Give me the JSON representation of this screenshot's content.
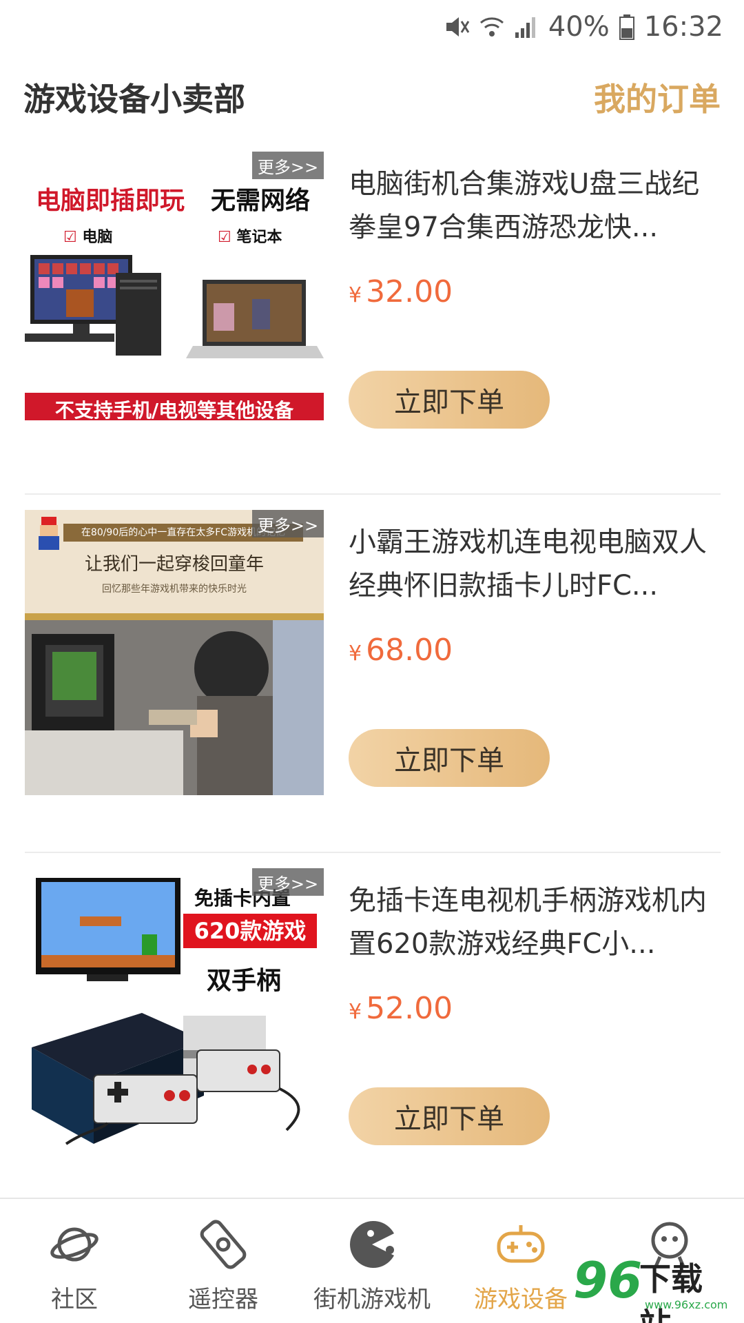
{
  "status_bar": {
    "battery": "40%",
    "time": "16:32"
  },
  "header": {
    "title": "游戏设备小卖部",
    "orders_link": "我的订单"
  },
  "products": [
    {
      "title": "电脑街机合集游戏U盘三战纪拳皇97合集西游恐龙快...",
      "currency": "¥",
      "price": "32.00",
      "more": "更多>>",
      "button": "立即下单",
      "image": {
        "line1_red": "电脑即插即玩",
        "line1_black": "无需网络",
        "check1": "电脑",
        "check2": "笔记本",
        "banner": "不支持手机/电视等其他设备"
      }
    },
    {
      "title": "小霸王游戏机连电视电脑双人经典怀旧款插卡儿时FC...",
      "currency": "¥",
      "price": "68.00",
      "more": "更多>>",
      "button": "立即下单",
      "image": {
        "caption_top": "在80/90后的心中一直存在太多FC游戏机的记忆",
        "headline": "让我们一起穿梭回童年",
        "sub": "回忆那些年游戏机带来的快乐时光"
      }
    },
    {
      "title": "免插卡连电视机手柄游戏机内置620款游戏经典FC小...",
      "currency": "¥",
      "price": "52.00",
      "more": "更多>>",
      "button": "立即下单",
      "image": {
        "line1": "免插卡内置",
        "banner": "620款游戏",
        "line3": "双手柄"
      }
    }
  ],
  "tabbar": [
    {
      "label": "社区",
      "icon": "planet-icon",
      "active": false
    },
    {
      "label": "遥控器",
      "icon": "remote-icon",
      "active": false
    },
    {
      "label": "街机游戏机",
      "icon": "pacman-icon",
      "active": false
    },
    {
      "label": "游戏设备",
      "icon": "gamepad-icon",
      "active": true
    },
    {
      "label": "",
      "icon": "robot-icon",
      "active": false
    }
  ],
  "watermark": {
    "logo": "96",
    "text": "下载站",
    "url": "www.96xz.com"
  },
  "colors": {
    "accent": "#e3a548",
    "price": "#f06a3c",
    "button_start": "#f2d3a6",
    "button_end": "#e5b87a"
  }
}
